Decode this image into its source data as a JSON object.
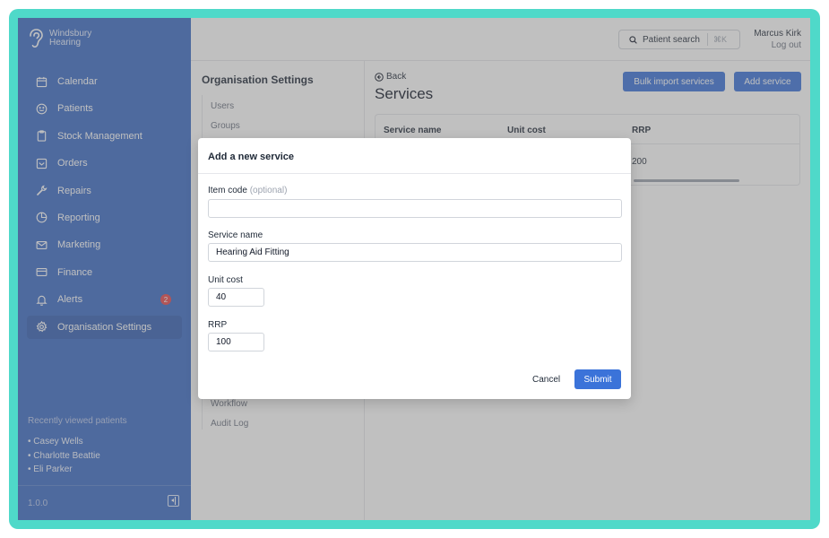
{
  "brand": {
    "line1": "Windsbury",
    "line2": "Hearing"
  },
  "sidebar": {
    "items": [
      {
        "label": "Calendar",
        "icon": "calendar-icon"
      },
      {
        "label": "Patients",
        "icon": "smile-icon"
      },
      {
        "label": "Stock Management",
        "icon": "clipboard-icon"
      },
      {
        "label": "Orders",
        "icon": "inbox-icon"
      },
      {
        "label": "Repairs",
        "icon": "wrench-icon"
      },
      {
        "label": "Reporting",
        "icon": "pie-chart-icon"
      },
      {
        "label": "Marketing",
        "icon": "mail-icon"
      },
      {
        "label": "Finance",
        "icon": "credit-card-icon"
      },
      {
        "label": "Alerts",
        "icon": "bell-icon",
        "badge": "2"
      },
      {
        "label": "Organisation Settings",
        "icon": "gear-icon",
        "active": true
      }
    ],
    "recent_title": "Recently viewed patients",
    "recent": [
      "• Casey Wells",
      "• Charlotte Beattie",
      "• Eli Parker"
    ],
    "version": "1.0.0"
  },
  "header": {
    "search_label": "Patient search",
    "search_shortcut": "⌘K",
    "user_name": "Marcus Kirk",
    "logout_label": "Log out"
  },
  "settings": {
    "title": "Organisation Settings",
    "links": [
      "Users",
      "Groups",
      "Workflow",
      "Audit Log"
    ]
  },
  "page": {
    "back_label": "Back",
    "title": "Services",
    "bulk_import_label": "Bulk import services",
    "add_service_label": "Add service",
    "table": {
      "headers": [
        "Service name",
        "Unit cost",
        "RRP"
      ],
      "visible_row": {
        "rrp": "200"
      }
    }
  },
  "modal": {
    "title": "Add a new service",
    "item_code_label": "Item code",
    "item_code_optional": "(optional)",
    "item_code_value": "",
    "service_name_label": "Service name",
    "service_name_value": "Hearing Aid Fitting",
    "unit_cost_label": "Unit cost",
    "unit_cost_value": "40",
    "rrp_label": "RRP",
    "rrp_value": "100",
    "cancel_label": "Cancel",
    "submit_label": "Submit"
  },
  "colors": {
    "sidebar": "#3c6bc4",
    "accent": "#3b73d9",
    "frame": "#4fd9c9",
    "badge": "#e8474a"
  }
}
